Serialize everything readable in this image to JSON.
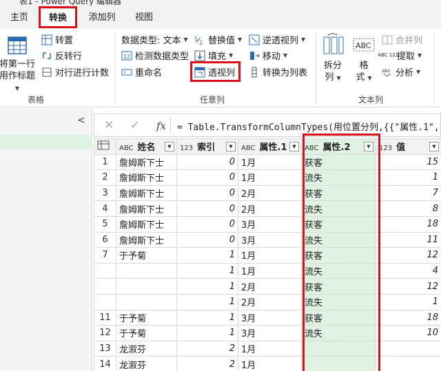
{
  "window": {
    "title": "表1 - Power Query 编辑器"
  },
  "tabs": [
    {
      "label": "主页"
    },
    {
      "label": "转换"
    },
    {
      "label": "添加列"
    },
    {
      "label": "视图"
    }
  ],
  "ribbon": {
    "table_group": {
      "label": "表格",
      "first_row_header": [
        "将第一行",
        "用作标题"
      ],
      "transpose": "转置",
      "reverse_rows": "反转行",
      "count_rows": "对行进行计数"
    },
    "any_column_group": {
      "label": "任意列",
      "data_type": "数据类型: 文本",
      "detect_type": "检测数据类型",
      "rename": "重命名",
      "replace_values": "替换值",
      "fill": "填充",
      "pivot_column": "透视列",
      "unpivot": "逆透视列",
      "move": "移动",
      "convert_to_list": "转换为列表"
    },
    "text_column_group": {
      "label": "文本列",
      "split_column": [
        "拆分",
        "列"
      ],
      "format": [
        "格",
        "式"
      ],
      "merge_columns": "合并列",
      "extract": "提取",
      "parse": "分析"
    },
    "cut_label": "ABC 123"
  },
  "formula_bar": {
    "text": "= Table.TransformColumnTypes(用位置分列,{{\"属性.1\", ty"
  },
  "table": {
    "columns": [
      {
        "type": "ABC",
        "name": "姓名"
      },
      {
        "type": "123",
        "name": "索引"
      },
      {
        "type": "ABC",
        "name": "属性.1"
      },
      {
        "type": "ABC",
        "name": "属性.2"
      },
      {
        "type": "123",
        "name": "值"
      }
    ],
    "rows": [
      {
        "idx": "1",
        "name": "詹姆斯下士",
        "index": "0",
        "attr1": "1月",
        "attr2": "获客",
        "value": "15"
      },
      {
        "idx": "2",
        "name": "詹姆斯下士",
        "index": "0",
        "attr1": "1月",
        "attr2": "流失",
        "value": "1"
      },
      {
        "idx": "3",
        "name": "詹姆斯下士",
        "index": "0",
        "attr1": "2月",
        "attr2": "获客",
        "value": "7"
      },
      {
        "idx": "4",
        "name": "詹姆斯下士",
        "index": "0",
        "attr1": "2月",
        "attr2": "流失",
        "value": "8"
      },
      {
        "idx": "5",
        "name": "詹姆斯下士",
        "index": "0",
        "attr1": "3月",
        "attr2": "获客",
        "value": "18"
      },
      {
        "idx": "6",
        "name": "詹姆斯下士",
        "index": "0",
        "attr1": "3月",
        "attr2": "流失",
        "value": "11"
      },
      {
        "idx": "7",
        "name": "于予菊",
        "index": "1",
        "attr1": "1月",
        "attr2": "获客",
        "value": "12"
      },
      {
        "idx": "",
        "name": "",
        "index": "1",
        "attr1": "1月",
        "attr2": "流失",
        "value": "4"
      },
      {
        "idx": "",
        "name": "",
        "index": "1",
        "attr1": "2月",
        "attr2": "获客",
        "value": "12"
      },
      {
        "idx": "",
        "name": "",
        "index": "1",
        "attr1": "2月",
        "attr2": "流失",
        "value": "1"
      },
      {
        "idx": "11",
        "name": "于予菊",
        "index": "1",
        "attr1": "3月",
        "attr2": "获客",
        "value": "18"
      },
      {
        "idx": "12",
        "name": "于予菊",
        "index": "1",
        "attr1": "3月",
        "attr2": "流失",
        "value": "10"
      },
      {
        "idx": "13",
        "name": "龙溆芬",
        "index": "2",
        "attr1": "1月",
        "attr2": "",
        "value": ""
      },
      {
        "idx": "14",
        "name": "龙溆芬",
        "index": "2",
        "attr1": "1月",
        "attr2": "",
        "value": ""
      }
    ]
  },
  "colors": {
    "accent_red": "#d9111a",
    "highlight_green": "#dff2e3"
  }
}
